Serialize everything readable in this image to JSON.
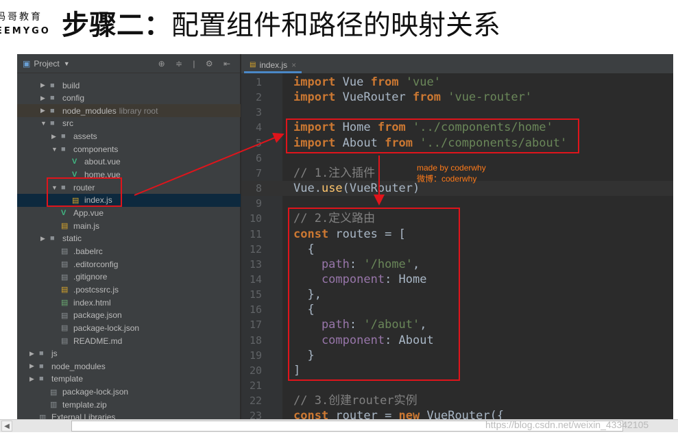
{
  "logo": {
    "cn": "码哥教育",
    "en": "EEMYGO"
  },
  "slide_title": {
    "step": "步骤二：",
    "text": "配置组件和路径的映射关系"
  },
  "project": {
    "label": "Project",
    "tools": "⊕ ≑ | ⚙ ⇤",
    "tree": [
      {
        "label": "build",
        "type": "folder",
        "level": 1,
        "open": false
      },
      {
        "label": "config",
        "type": "folder",
        "level": 1,
        "open": false
      },
      {
        "label": "node_modules",
        "hint": "library root",
        "type": "folder",
        "level": 1,
        "open": false
      },
      {
        "label": "src",
        "type": "folder",
        "level": 1,
        "open": true
      },
      {
        "label": "assets",
        "type": "folder",
        "level": 2,
        "open": false
      },
      {
        "label": "components",
        "type": "folder",
        "level": 2,
        "open": true
      },
      {
        "label": "about.vue",
        "type": "vue",
        "level": 3
      },
      {
        "label": "home.vue",
        "type": "vue",
        "level": 3
      },
      {
        "label": "router",
        "type": "folder",
        "level": 2,
        "open": true
      },
      {
        "label": "index.js",
        "type": "js",
        "level": 3,
        "selected": true
      },
      {
        "label": "App.vue",
        "type": "vue",
        "level": 2
      },
      {
        "label": "main.js",
        "type": "js",
        "level": 2
      },
      {
        "label": "static",
        "type": "folder",
        "level": 1,
        "open": false
      },
      {
        "label": ".babelrc",
        "type": "file",
        "level": 2
      },
      {
        "label": ".editorconfig",
        "type": "file",
        "level": 2
      },
      {
        "label": ".gitignore",
        "type": "file",
        "level": 2
      },
      {
        "label": ".postcssrc.js",
        "type": "js",
        "level": 2
      },
      {
        "label": "index.html",
        "type": "html",
        "level": 2
      },
      {
        "label": "package.json",
        "type": "file",
        "level": 2
      },
      {
        "label": "package-lock.json",
        "type": "file",
        "level": 2
      },
      {
        "label": "README.md",
        "type": "file",
        "level": 2
      },
      {
        "label": "js",
        "type": "folder",
        "level": 0,
        "open": false
      },
      {
        "label": "node_modules",
        "type": "folder",
        "level": 0,
        "open": false
      },
      {
        "label": "template",
        "type": "folder",
        "level": 0,
        "open": false
      },
      {
        "label": "package-lock.json",
        "type": "file",
        "level": 1
      },
      {
        "label": "template.zip",
        "type": "zip",
        "level": 1
      },
      {
        "label": "External Libraries",
        "type": "lib",
        "level": 0
      }
    ]
  },
  "editor": {
    "tab": "index.js",
    "current_line": 8,
    "lines": [
      [
        [
          "k",
          "import"
        ],
        [
          "t",
          " Vue "
        ],
        [
          "k",
          "from"
        ],
        [
          "t",
          " "
        ],
        [
          "s",
          "'vue'"
        ]
      ],
      [
        [
          "k",
          "import"
        ],
        [
          "t",
          " VueRouter "
        ],
        [
          "k",
          "from"
        ],
        [
          "t",
          " "
        ],
        [
          "s",
          "'vue-router'"
        ]
      ],
      [],
      [
        [
          "k",
          "import"
        ],
        [
          "t",
          " Home "
        ],
        [
          "k",
          "from"
        ],
        [
          "t",
          " "
        ],
        [
          "s",
          "'../components/home'"
        ]
      ],
      [
        [
          "k",
          "import"
        ],
        [
          "t",
          " About "
        ],
        [
          "k",
          "from"
        ],
        [
          "t",
          " "
        ],
        [
          "s",
          "'../components/about'"
        ]
      ],
      [],
      [
        [
          "c",
          "// 1.注入插件"
        ]
      ],
      [
        [
          "t",
          "Vue."
        ],
        [
          "f",
          "use"
        ],
        [
          "t",
          "(VueRouter)"
        ]
      ],
      [],
      [
        [
          "c",
          "// 2.定义路由"
        ]
      ],
      [
        [
          "k",
          "const"
        ],
        [
          "t",
          " routes = ["
        ]
      ],
      [
        [
          "t",
          "  {"
        ]
      ],
      [
        [
          "p",
          "    path"
        ],
        [
          "t",
          ": "
        ],
        [
          "s",
          "'/home'"
        ],
        [
          "t",
          ","
        ]
      ],
      [
        [
          "p",
          "    component"
        ],
        [
          "t",
          ": Home"
        ]
      ],
      [
        [
          "t",
          "  },"
        ]
      ],
      [
        [
          "t",
          "  {"
        ]
      ],
      [
        [
          "p",
          "    path"
        ],
        [
          "t",
          ": "
        ],
        [
          "s",
          "'/about'"
        ],
        [
          "t",
          ","
        ]
      ],
      [
        [
          "p",
          "    component"
        ],
        [
          "t",
          ": About"
        ]
      ],
      [
        [
          "t",
          "  }"
        ]
      ],
      [
        [
          "t",
          "]"
        ]
      ],
      [],
      [
        [
          "c",
          "// 3.创建router实例"
        ]
      ],
      [
        [
          "k",
          "const"
        ],
        [
          "t",
          " router = "
        ],
        [
          "k",
          "new"
        ],
        [
          "t",
          " VueRouter({"
        ]
      ]
    ]
  },
  "annotation": {
    "line1": "made by coderwhy",
    "line2": "微博：coderwhy"
  },
  "watermark": "https://blog.csdn.net/weixin_43342105",
  "colors": {
    "highlight_box": "#e0141b",
    "keyword": "#cc7832",
    "string": "#6a8759",
    "property": "#9876aa"
  }
}
